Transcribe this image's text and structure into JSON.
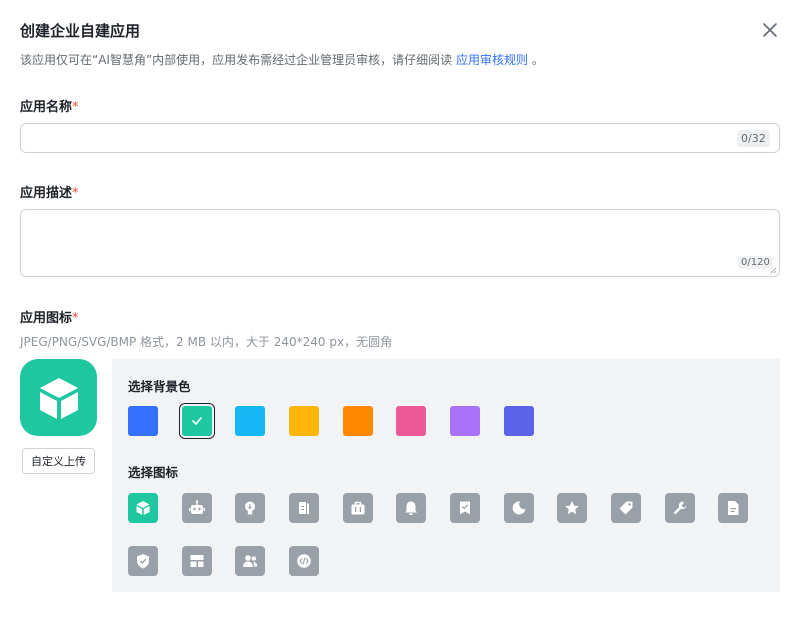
{
  "dialog": {
    "title": "创建企业自建应用",
    "subtitle_prefix": "该应用仅可在“AI智慧角”内部使用，应用发布需经过企业管理员审核，请仔细阅读 ",
    "subtitle_link": "应用审核规则",
    "subtitle_suffix": " 。"
  },
  "name_field": {
    "label": "应用名称",
    "required_mark": "*",
    "value": "",
    "counter": "0/32"
  },
  "desc_field": {
    "label": "应用描述",
    "required_mark": "*",
    "value": "",
    "counter": "0/120"
  },
  "icon_field": {
    "label": "应用图标",
    "required_mark": "*",
    "hint": "JPEG/PNG/SVG/BMP 格式，2 MB 以内，大于 240*240 px，无圆角",
    "upload_label": "自定义上传",
    "bg_label": "选择背景色",
    "icon_label": "选择图标",
    "bg_colors": [
      "#3370ff",
      "#1fc7a0",
      "#14b8f4",
      "#ffb60a",
      "#ff8800",
      "#eb5996",
      "#a872f9",
      "#5b63e8"
    ],
    "selected_bg": 1,
    "icons": [
      "cube-icon",
      "robot-icon",
      "lightbulb-icon",
      "document-icon",
      "briefcase-icon",
      "bell-icon",
      "bookmark-icon",
      "moon-icon",
      "star-icon",
      "tag-icon",
      "wrench-icon",
      "file-icon",
      "shield-icon",
      "layout-icon",
      "people-icon",
      "code-icon"
    ],
    "selected_icon": 0
  },
  "colors": {
    "accent": "#3370ff",
    "selected_tile": "#1fc7a0",
    "tile": "#9aa0a8",
    "panel_bg": "#f2f3f5",
    "required": "#f54a45"
  }
}
